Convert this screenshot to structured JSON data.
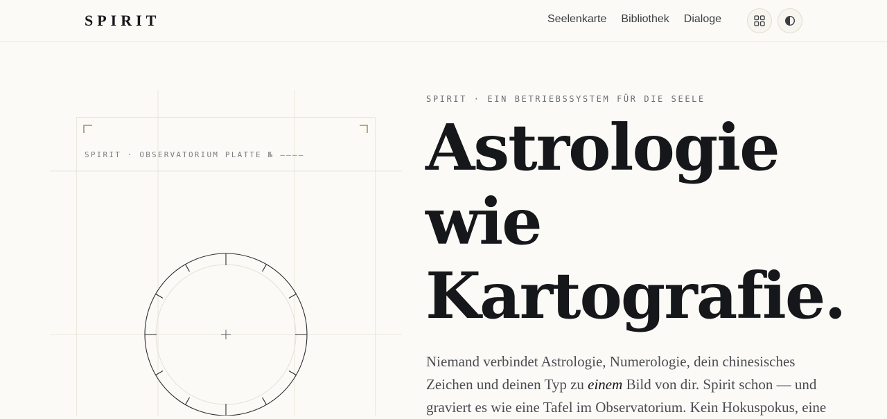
{
  "header": {
    "brand": "SPIRIT",
    "nav": [
      {
        "label": "Seelenkarte"
      },
      {
        "label": "Bibliothek"
      },
      {
        "label": "Dialoge"
      }
    ],
    "icons": {
      "grid": "grid-icon",
      "theme": "contrast-icon"
    }
  },
  "plate": {
    "label": "SPIRIT · OBSERVATORIUM PLATTE № ––––"
  },
  "hero": {
    "eyebrow": "SPIRIT · EIN BETRIEBSSYSTEM FÜR DIE SEELE",
    "headline": [
      "Astrologie",
      "wie",
      "Kartografie."
    ],
    "lede_before": "Niemand verbindet Astrologie, Numerologie, dein chinesisches Zeichen und deinen Typ zu ",
    "lede_emphasis": "einem",
    "lede_after": " Bild von dir. Spirit schon — und graviert es wie eine Tafel im Observatorium. Kein Hokuspokus, eine"
  },
  "colors": {
    "background": "#fbfaf6",
    "ink": "#16171a",
    "accent": "#a8885a",
    "rule": "#e9e3d3"
  }
}
